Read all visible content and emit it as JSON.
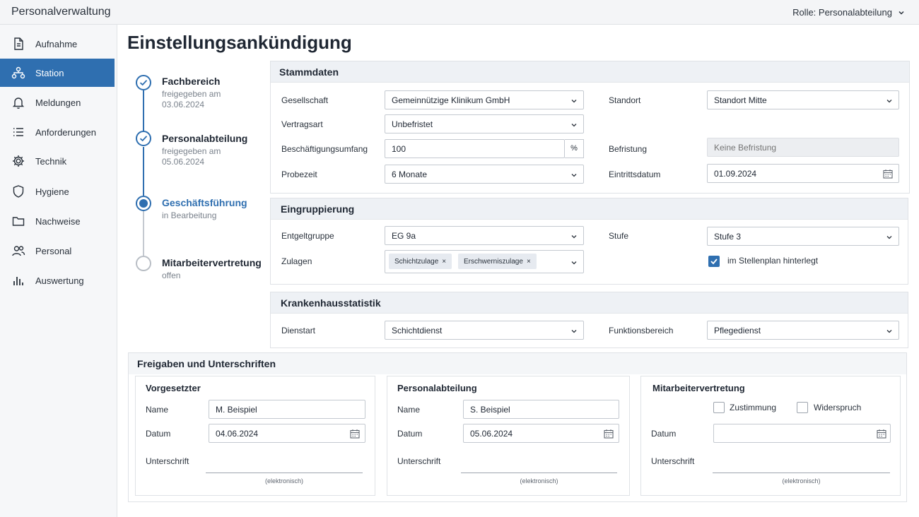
{
  "app": {
    "title": "Personalverwaltung",
    "role": "Rolle: Personalabteilung"
  },
  "sidebar": {
    "items": [
      {
        "label": "Aufnahme",
        "icon": "document-icon"
      },
      {
        "label": "Station",
        "icon": "network-icon",
        "active": true
      },
      {
        "label": "Meldungen",
        "icon": "bell-icon"
      },
      {
        "label": "Anforderungen",
        "icon": "list-icon"
      },
      {
        "label": "Technik",
        "icon": "gear-icon"
      },
      {
        "label": "Hygiene",
        "icon": "shield-icon"
      },
      {
        "label": "Nachweise",
        "icon": "folder-icon"
      },
      {
        "label": "Personal",
        "icon": "people-icon"
      },
      {
        "label": "Auswertung",
        "icon": "bar-chart-icon"
      }
    ]
  },
  "page": {
    "title": "Einstellungsankündigung"
  },
  "steps": [
    {
      "name": "Fachbereich",
      "status": "freigegeben am 03.06.2024",
      "state": "done"
    },
    {
      "name": "Personalabteilung",
      "status": "freigegeben am 05.06.2024",
      "state": "done"
    },
    {
      "name": "Geschäftsführung",
      "status": "in Bearbeitung",
      "state": "current"
    },
    {
      "name": "Mitarbeitervertretung",
      "status": "offen",
      "state": "open"
    }
  ],
  "stammdaten": {
    "title": "Stammdaten",
    "gesellschaft_label": "Gesellschaft",
    "gesellschaft_value": "Gemeinnützige Klinikum GmbH",
    "standort_label": "Standort",
    "standort_value": "Standort Mitte",
    "vertragsart_label": "Vertragsart",
    "vertragsart_value": "Unbefristet",
    "umfang_label": "Beschäftigungsumfang",
    "umfang_value": "100",
    "umfang_unit": "%",
    "befristung_label": "Befristung",
    "befristung_placeholder": "Keine Befristung",
    "probezeit_label": "Probezeit",
    "probezeit_value": "6 Monate",
    "eintritt_label": "Eintrittsdatum",
    "eintritt_value": "01.09.2024"
  },
  "eingruppierung": {
    "title": "Eingruppierung",
    "entgelt_label": "Entgeltgruppe",
    "entgelt_value": "EG 9a",
    "stufe_label": "Stufe",
    "stufe_value": "Stufe 3",
    "zulagen_label": "Zulagen",
    "zulagen": [
      "Schichtzulage",
      "Erschwerniszulage"
    ],
    "chip_remove": "×",
    "stellenplan_label": "im Stellenplan hinterlegt",
    "stellenplan_checked": true
  },
  "statistik": {
    "title": "Krankenhausstatistik",
    "dienstart_label": "Dienstart",
    "dienstart_value": "Schichtdienst",
    "funktion_label": "Funktionsbereich",
    "funktion_value": "Pflegedienst"
  },
  "freigaben": {
    "title": "Freigaben und Unterschriften",
    "vorgesetzter": {
      "title": "Vorgesetzter",
      "name_label": "Name",
      "name_value": "M. Beispiel",
      "datum_label": "Datum",
      "datum_value": "04.06.2024",
      "sig_label": "Unterschrift",
      "sig_note": "(elektronisch)"
    },
    "personal": {
      "title": "Personalabteilung",
      "name_label": "Name",
      "name_value": "S. Beispiel",
      "datum_label": "Datum",
      "datum_value": "05.06.2024",
      "sig_label": "Unterschrift",
      "sig_note": "(elektronisch)"
    },
    "mav": {
      "title": "Mitarbeitervertretung",
      "zustimmung_label": "Zustimmung",
      "widerspruch_label": "Widerspruch",
      "datum_label": "Datum",
      "datum_value": "",
      "sig_label": "Unterschrift",
      "sig_note": "(elektronisch)"
    }
  },
  "colors": {
    "accent": "#2f6fb0",
    "panel_head": "#eef1f5",
    "sidebar": "#f6f7f9"
  }
}
